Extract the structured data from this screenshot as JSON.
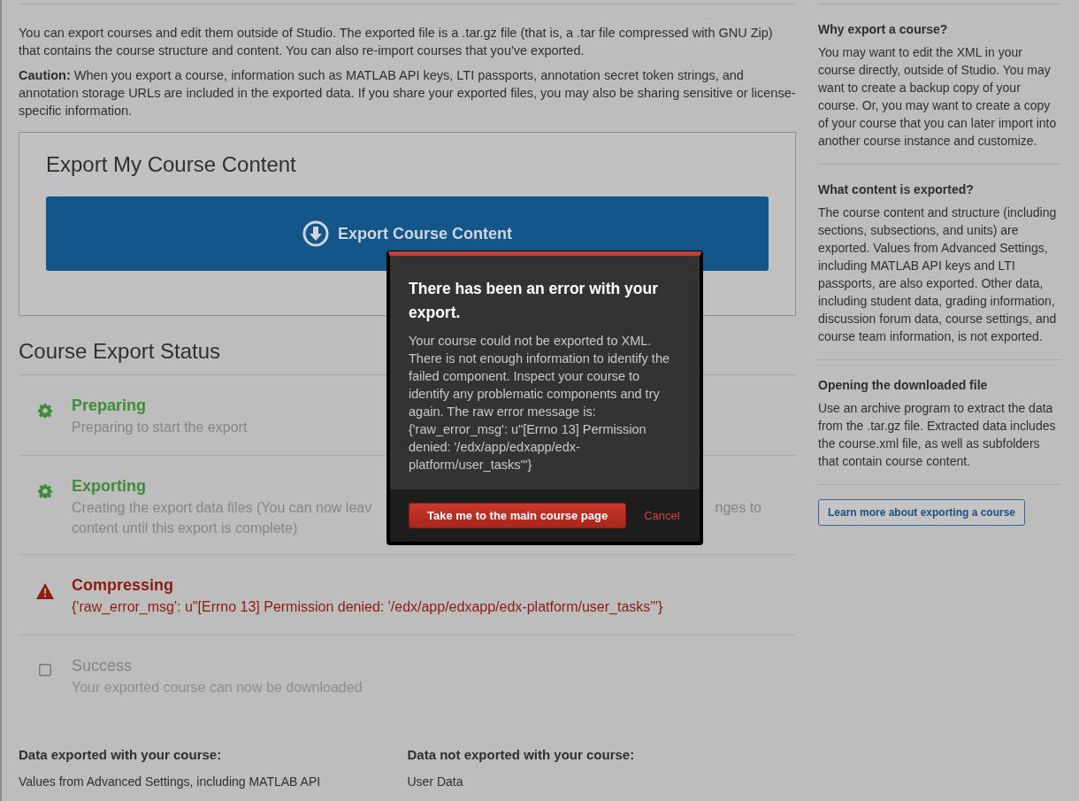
{
  "intro": [
    "You can export courses and edit them outside of Studio. The exported file is a .tar.gz file (that is, a .tar file compressed with GNU Zip) that contains the course structure and content. You can also re-import courses that you've exported.",
    "**Caution:** When you export a course, information such as MATLAB API keys, LTI passports, annotation secret token strings, and annotation storage URLs are included in the exported data. If you share your exported files, you may also be sharing sensitive or license-specific information."
  ],
  "export_box": {
    "title": "Export My Course Content",
    "button": "Export Course Content"
  },
  "status": {
    "title": "Course Export Status",
    "steps": [
      {
        "kind": "progress",
        "title": "Preparing",
        "lines": [
          [
            "Preparing to start the export"
          ]
        ]
      },
      {
        "kind": "progress",
        "title": "Exporting",
        "lines": [
          [
            "Creating the export data files (You can now leav",
            "nges to"
          ],
          [
            "content until this export is complete)"
          ]
        ]
      },
      {
        "kind": "error",
        "title": "Compressing",
        "lines": [
          [
            "{'raw_error_msg': u\"[Errno 13] Permission denied: '/edx/app/edxapp/edx-platform/user_tasks'\"}"
          ]
        ]
      },
      {
        "kind": "pending",
        "title": "Success",
        "lines": [
          [
            "Your exported course can now be downloaded"
          ]
        ]
      }
    ]
  },
  "data_lists": [
    {
      "title": "Data exported with your course:",
      "items": [
        "Values from Advanced Settings, including MATLAB API"
      ]
    },
    {
      "title": "Data not exported with your course:",
      "items": [
        "User Data"
      ]
    }
  ],
  "sidebar": {
    "sections": [
      {
        "title": "Why export a course?",
        "text": "You may want to edit the XML in your course directly, outside of Studio. You may want to create a backup copy of your course. Or, you may want to create a copy of your course that you can later import into another course instance and customize."
      },
      {
        "title": "What content is exported?",
        "text": "The course content and structure (including sections, subsections, and units) are exported. Values from Advanced Settings, including MATLAB API keys and LTI passports, are also exported. Other data, including student data, grading information, discussion forum data, course settings, and course team information, is not exported."
      },
      {
        "title": "Opening the downloaded file",
        "text": "Use an archive program to extract the data from the .tar.gz file. Extracted data includes the course.xml file, as well as subfolders that contain course content."
      }
    ],
    "link_button": "Learn more about exporting a course"
  },
  "modal": {
    "title": "There has been an error with your export.",
    "message": "Your course could not be exported to XML. There is not enough information to identify the failed component. Inspect your course to identify any problematic components and try again. The raw error message is: {'raw_error_msg': u\"[Errno 13] Permission denied: '/edx/app/edxapp/edx-platform/user_tasks'\"}",
    "primary_button": "Take me to the main course page",
    "cancel": "Cancel"
  }
}
